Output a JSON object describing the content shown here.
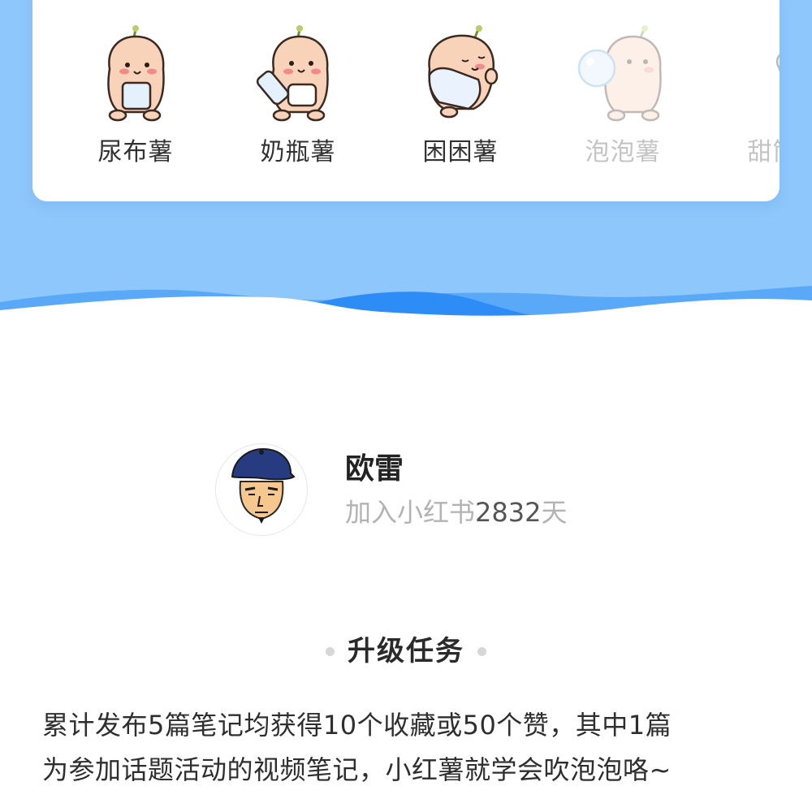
{
  "levels": [
    {
      "name": "尿布薯",
      "icon": "potato-diaper-icon",
      "unlocked": true
    },
    {
      "name": "奶瓶薯",
      "icon": "potato-bottle-icon",
      "unlocked": true
    },
    {
      "name": "困困薯",
      "icon": "potato-pillow-icon",
      "unlocked": true
    },
    {
      "name": "泡泡薯",
      "icon": "potato-bubble-icon",
      "unlocked": false
    },
    {
      "name": "甜筒薯",
      "icon": "potato-icecream-icon",
      "unlocked": false
    }
  ],
  "profile": {
    "name": "欧雷",
    "join_prefix": "加入小红书",
    "join_days": "2832",
    "join_suffix": "天"
  },
  "task": {
    "title": "升级任务",
    "description_line1": "累计发布5篇笔记均获得10个收藏或50个赞，其中1篇",
    "description_line2": "为参加话题活动的视频笔记，小红薯就学会吹泡泡咯~"
  },
  "colors": {
    "hero_blue": "#8ec7fb",
    "wave_deep": "#2d8cf5",
    "card_bg": "#ffffff",
    "locked_text": "#c4c4c4"
  }
}
